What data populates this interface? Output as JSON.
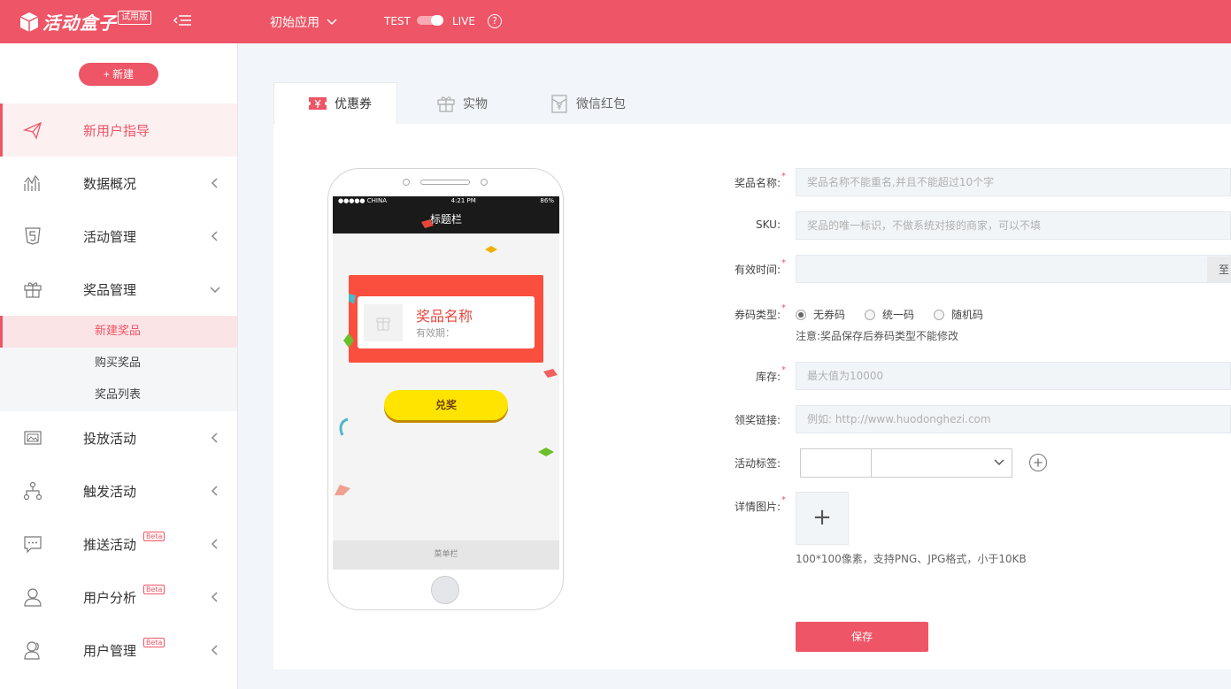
{
  "header": {
    "logo_text": "活动盒子",
    "trial_badge": "试用版",
    "app_name": "初始应用",
    "env_test": "TEST",
    "env_live": "LIVE",
    "help": "?"
  },
  "sidebar": {
    "new_button": "+ 新建",
    "items": [
      {
        "label": "新用户指导",
        "icon": "paper-plane-icon"
      },
      {
        "label": "数据概况",
        "icon": "chart-icon"
      },
      {
        "label": "活动管理",
        "icon": "html5-icon"
      },
      {
        "label": "奖品管理",
        "icon": "gift-icon"
      },
      {
        "label": "投放活动",
        "icon": "image-icon"
      },
      {
        "label": "触发活动",
        "icon": "tree-icon"
      },
      {
        "label": "推送活动",
        "icon": "message-icon",
        "badge": "Beta"
      },
      {
        "label": "用户分析",
        "icon": "user-icon",
        "badge": "Beta"
      },
      {
        "label": "用户管理",
        "icon": "users-icon",
        "badge": "Beta"
      }
    ],
    "sub_items": [
      "新建奖品",
      "购买奖品",
      "奖品列表"
    ]
  },
  "tabs": [
    {
      "label": "优惠券"
    },
    {
      "label": "实物"
    },
    {
      "label": "微信红包"
    }
  ],
  "phone": {
    "carrier": "●●●●● CHINA",
    "time": "4:21 PM",
    "battery": "86%",
    "title": "标题栏",
    "coupon_name": "奖品名称",
    "coupon_validity": "有效期：",
    "redeem_button": "兑奖",
    "menu_bar": "菜单栏"
  },
  "form": {
    "name_label": "奖品名称:",
    "name_placeholder": "奖品名称不能重名,并且不能超过10个字",
    "sku_label": "SKU:",
    "sku_placeholder": "奖品的唯一标识，不做系统对接的商家，可以不填",
    "validity_label": "有效时间:",
    "to_label": "至",
    "code_type_label": "券码类型:",
    "code_types": [
      "无券码",
      "统一码",
      "随机码"
    ],
    "code_type_selected": "无券码",
    "code_note": "注意:奖品保存后券码类型不能修改",
    "stock_label": "库存:",
    "stock_placeholder": "最大值为10000",
    "link_label": "领奖链接:",
    "link_placeholder": "例如: http://www.huodonghezi.com",
    "tag_label": "活动标签:",
    "image_label": "详情图片:",
    "image_hint": "100*100像素，支持PNG、JPG格式，小于10KB",
    "save_button": "保存"
  },
  "colors": {
    "brand": "#ee5566",
    "coupon": "#fa4f3f",
    "redeem": "#ffe400"
  }
}
